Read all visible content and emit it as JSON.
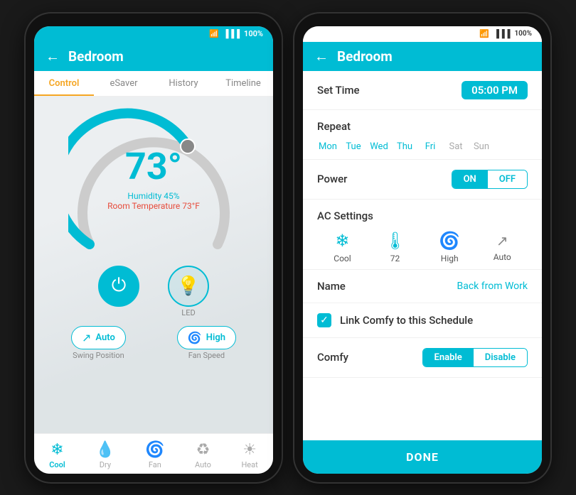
{
  "left_phone": {
    "status": {
      "wifi": "📶",
      "signal": "▐▐▐",
      "battery": "100%"
    },
    "header": {
      "back": "←",
      "title": "Bedroom"
    },
    "tabs": [
      {
        "label": "Control",
        "active": true
      },
      {
        "label": "eSaver",
        "active": false
      },
      {
        "label": "History",
        "active": false
      },
      {
        "label": "Timeline",
        "active": false
      }
    ],
    "thermostat": {
      "temperature": "73°",
      "humidity": "Humidity 45%",
      "room_temp": "Room Temperature 73°F"
    },
    "swing": {
      "label": "Auto",
      "sub": "Swing Position"
    },
    "fan": {
      "label": "High",
      "sub": "Fan Speed"
    },
    "led_label": "LED",
    "modes": [
      {
        "label": "Cool",
        "icon": "❄",
        "active": true
      },
      {
        "label": "Dry",
        "icon": "💧",
        "active": false
      },
      {
        "label": "Fan",
        "icon": "🌀",
        "active": false
      },
      {
        "label": "Auto",
        "icon": "♻",
        "active": false
      },
      {
        "label": "Heat",
        "icon": "☀",
        "active": false
      }
    ]
  },
  "right_phone": {
    "status": {
      "wifi": "📶",
      "signal": "▐▐▐",
      "battery": "100%"
    },
    "header": {
      "back": "←",
      "title": "Bedroom"
    },
    "set_time_label": "Set Time",
    "set_time_value": "05:00 PM",
    "repeat_label": "Repeat",
    "days": [
      {
        "label": "Mon",
        "active": true
      },
      {
        "label": "Tue",
        "active": true
      },
      {
        "label": "Wed",
        "active": true
      },
      {
        "label": "Thu",
        "active": true
      },
      {
        "label": "Fri",
        "active": true
      },
      {
        "label": "Sat",
        "active": false
      },
      {
        "label": "Sun",
        "active": false
      }
    ],
    "power_label": "Power",
    "power_on": "ON",
    "power_off": "OFF",
    "ac_settings_label": "AC Settings",
    "ac_icons": [
      {
        "symbol": "❄",
        "label": "Cool"
      },
      {
        "symbol": "🌡",
        "label": "72"
      },
      {
        "symbol": "🌀",
        "label": "High"
      },
      {
        "symbol": "↗",
        "label": "Auto"
      }
    ],
    "name_label": "Name",
    "name_value": "Back from Work",
    "link_comfy_label": "Link Comfy to this Schedule",
    "comfy_label": "Comfy",
    "comfy_enable": "Enable",
    "comfy_disable": "Disable",
    "done_label": "DONE"
  }
}
